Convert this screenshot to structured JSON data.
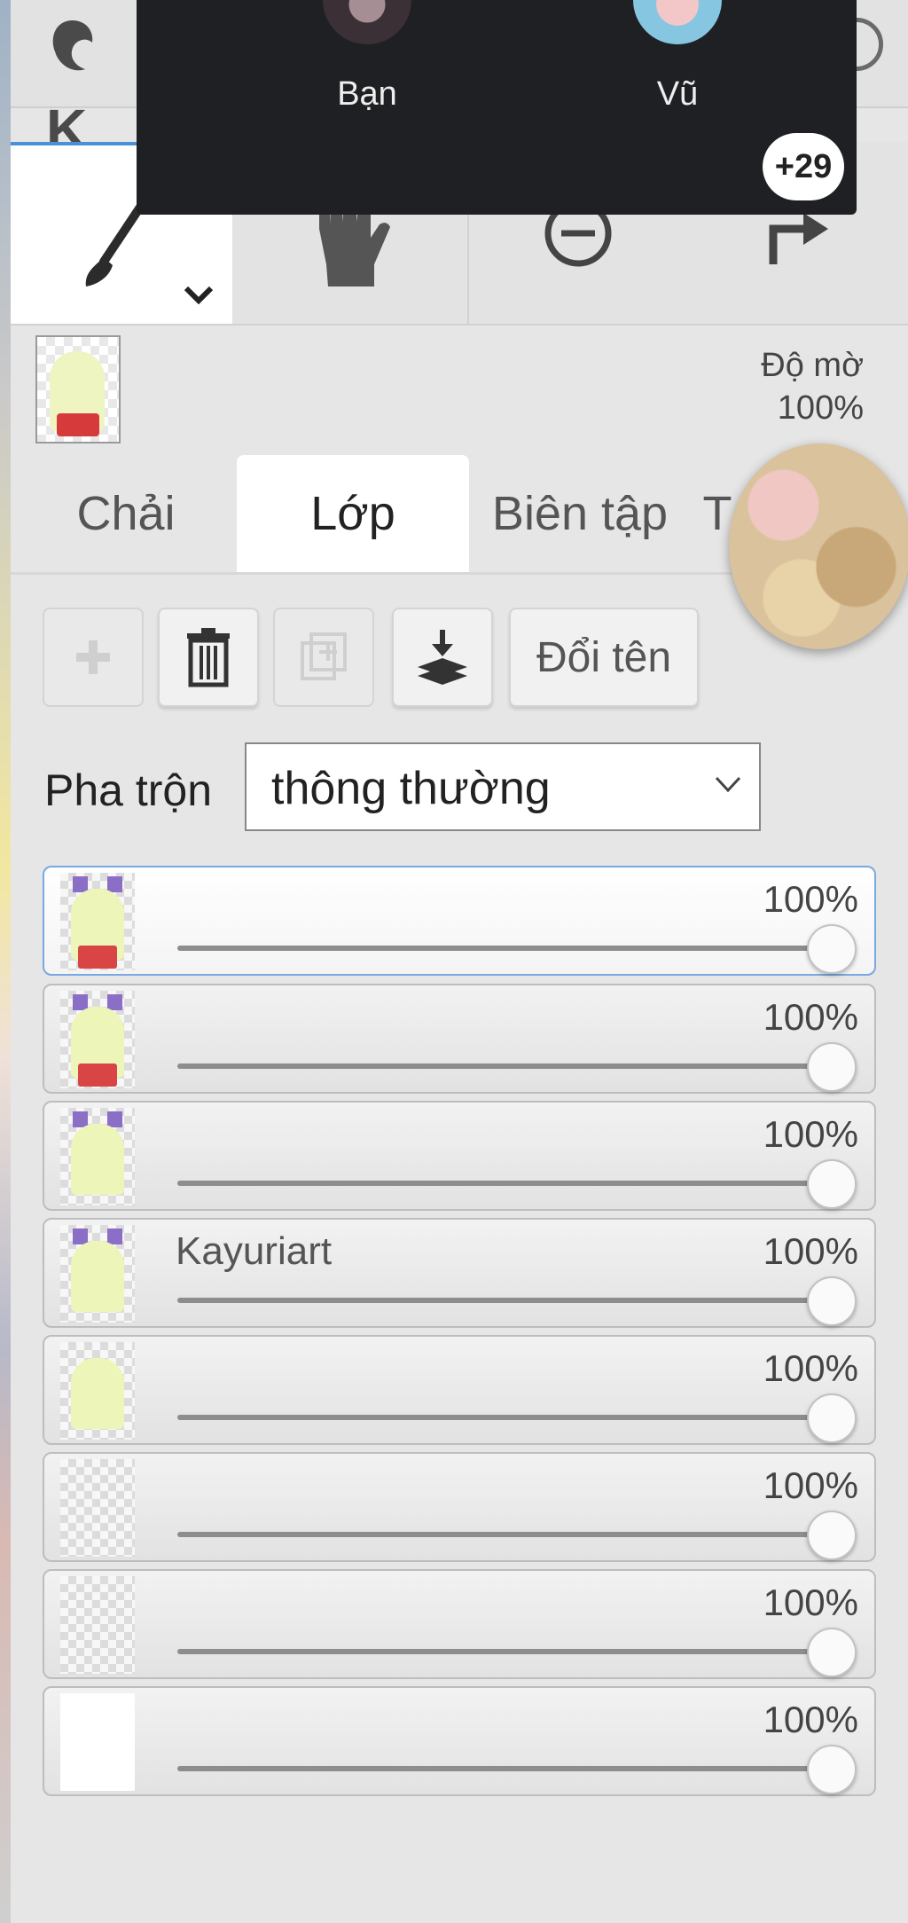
{
  "header": {
    "logo_icon": "app-logo-icon",
    "logo_letter": "K"
  },
  "tools": {
    "brush": "brush-icon",
    "hand": "hand-icon",
    "zoom": "zoom-out-icon",
    "redo": "redo-icon"
  },
  "opacity": {
    "label": "Độ mờ",
    "value": "100%"
  },
  "tabs": [
    {
      "label": "Chải",
      "active": false
    },
    {
      "label": "Lớp",
      "active": true
    },
    {
      "label": "Biên tập",
      "active": false
    },
    {
      "label": "T",
      "active": false
    }
  ],
  "layer_actions": {
    "rename_label": "Đổi tên"
  },
  "blend": {
    "label": "Pha trộn",
    "value": "thông thường"
  },
  "layers": [
    {
      "name": "",
      "opacity": "100%",
      "opacity_value": 100,
      "selected": true
    },
    {
      "name": "",
      "opacity": "100%",
      "opacity_value": 100,
      "selected": false
    },
    {
      "name": "",
      "opacity": "100%",
      "opacity_value": 100,
      "selected": false
    },
    {
      "name": "Kayuriart",
      "opacity": "100%",
      "opacity_value": 100,
      "selected": false
    },
    {
      "name": "",
      "opacity": "100%",
      "opacity_value": 100,
      "selected": false
    },
    {
      "name": "",
      "opacity": "100%",
      "opacity_value": 100,
      "selected": false
    },
    {
      "name": "",
      "opacity": "100%",
      "opacity_value": 100,
      "selected": false
    },
    {
      "name": "",
      "opacity": "100%",
      "opacity_value": 100,
      "selected": false
    }
  ],
  "overlay": {
    "contacts": [
      {
        "name": "Bạn"
      },
      {
        "name": "Vũ"
      }
    ],
    "more_count": "+29"
  },
  "colors": {
    "accent": "#4a90d9",
    "overlay_bg": "#1f2023",
    "panel_bg": "#e6e6e6"
  }
}
